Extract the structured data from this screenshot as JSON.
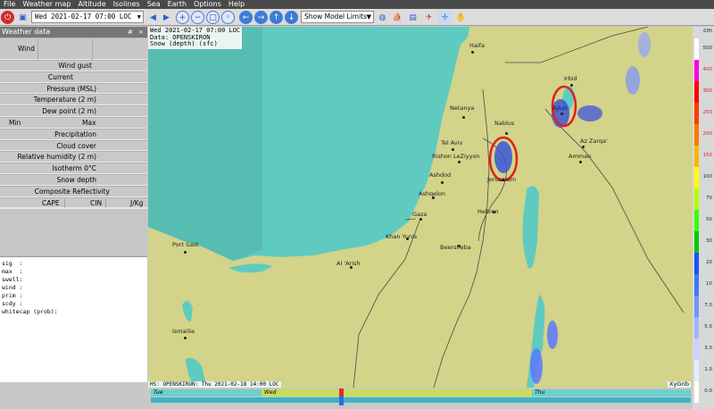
{
  "menu": [
    "File",
    "Weather map",
    "Altitude",
    "Isolines",
    "Sea",
    "Earth",
    "Options",
    "Help"
  ],
  "toolbar": {
    "date_combo": "Wed 2021-02-17 07:00 LOC",
    "model_limits": "Show Model Limits",
    "icons": [
      "stop-icon",
      "open-icon",
      "prev-icon",
      "next-icon",
      "zoom-in-icon",
      "zoom-out-icon",
      "zoom-area-icon",
      "zoom-fit-icon",
      "back-icon",
      "forward-icon",
      "up-icon",
      "down-icon",
      "meteotable-icon",
      "boat-icon",
      "save-image-icon",
      "rocket-icon",
      "cross-icon",
      "hand-icon"
    ]
  },
  "weather_panel": {
    "title": "Weather data",
    "header_buttons": [
      "#",
      "×"
    ],
    "rows": [
      {
        "name": "wind",
        "label": "Wind"
      },
      {
        "name": "wind-gust",
        "label": "Wind gust"
      },
      {
        "name": "current",
        "label": "Current"
      },
      {
        "name": "pressure",
        "label": "Pressure (MSL)"
      },
      {
        "name": "temperature",
        "label": "Temperature (2 m)"
      },
      {
        "name": "dew-point",
        "label": "Dew point (2 m)"
      },
      {
        "name": "min-max",
        "min": "Min",
        "max": "Max"
      },
      {
        "name": "precipitation",
        "label": "Precipitation"
      },
      {
        "name": "cloud-cover",
        "label": "Cloud cover"
      },
      {
        "name": "humidity",
        "label": "Relative humidity (2 m)"
      },
      {
        "name": "isotherm",
        "label": "Isotherm 0°C"
      },
      {
        "name": "snow-depth",
        "label": "Snow depth"
      },
      {
        "name": "reflectivity",
        "label": "Composite Reflectivity"
      },
      {
        "name": "cape",
        "cape": "CAPE",
        "cin": "CIN",
        "unit": "J/Kg"
      }
    ],
    "wave_text": "sig  :\nmax  :\nswell:\nwind :\nprim :\nscdy :\nwhitecap (prob):"
  },
  "map": {
    "info_lines": [
      "Wed 2021-02-17 07:00 LOC",
      "Data: OPENSKIRON",
      "Snow (depth) (sfc)"
    ],
    "bottom_note": "HS: OPENSKIRON: Thu 2021-02-18 14:00 LOC",
    "credit": "XyGrib",
    "cities": [
      "Haifa",
      "Irbid",
      "Netanya",
      "Ajlun",
      "Nablus",
      "Tel Aviv",
      "Rishon LeZiyyon",
      "Az Zarqa'",
      "Amman",
      "Ashdod",
      "Jerusalem",
      "Ashqelon",
      "Hebron",
      "Gaza",
      "Khan Yunis",
      "Beersheba",
      "Port Said",
      "Al 'Arish",
      "Ismailia"
    ]
  },
  "timeline": {
    "days": [
      "Tue",
      "Wed",
      "Thu"
    ]
  },
  "legend": {
    "unit": "cm",
    "steps": [
      {
        "value": "500",
        "color": "#ffffff"
      },
      {
        "value": "400",
        "color": "#ff00d8"
      },
      {
        "value": "300",
        "color": "#ff0000"
      },
      {
        "value": "250",
        "color": "#ff3c00"
      },
      {
        "value": "200",
        "color": "#ff7800"
      },
      {
        "value": "150",
        "color": "#ffb400"
      },
      {
        "value": "100",
        "color": "#ffff00"
      },
      {
        "value": "70",
        "color": "#b4ff00"
      },
      {
        "value": "50",
        "color": "#3cff00"
      },
      {
        "value": "30",
        "color": "#00c800"
      },
      {
        "value": "20",
        "color": "#1e50ff"
      },
      {
        "value": "10",
        "color": "#3c78ff"
      },
      {
        "value": "7.0",
        "color": "#6e96ff"
      },
      {
        "value": "5.0",
        "color": "#a0b4ff"
      },
      {
        "value": "3.0",
        "color": "#c8d2ff"
      },
      {
        "value": "1.0",
        "color": "#e6ebff"
      },
      {
        "value": "0.0",
        "color": "#ffffff"
      }
    ]
  },
  "colors": {
    "sea": "#5fcbc0",
    "land": "#d3d389",
    "lake": "#5fcbc0",
    "highlight": "#e02020",
    "snow": "#3b55d8"
  }
}
